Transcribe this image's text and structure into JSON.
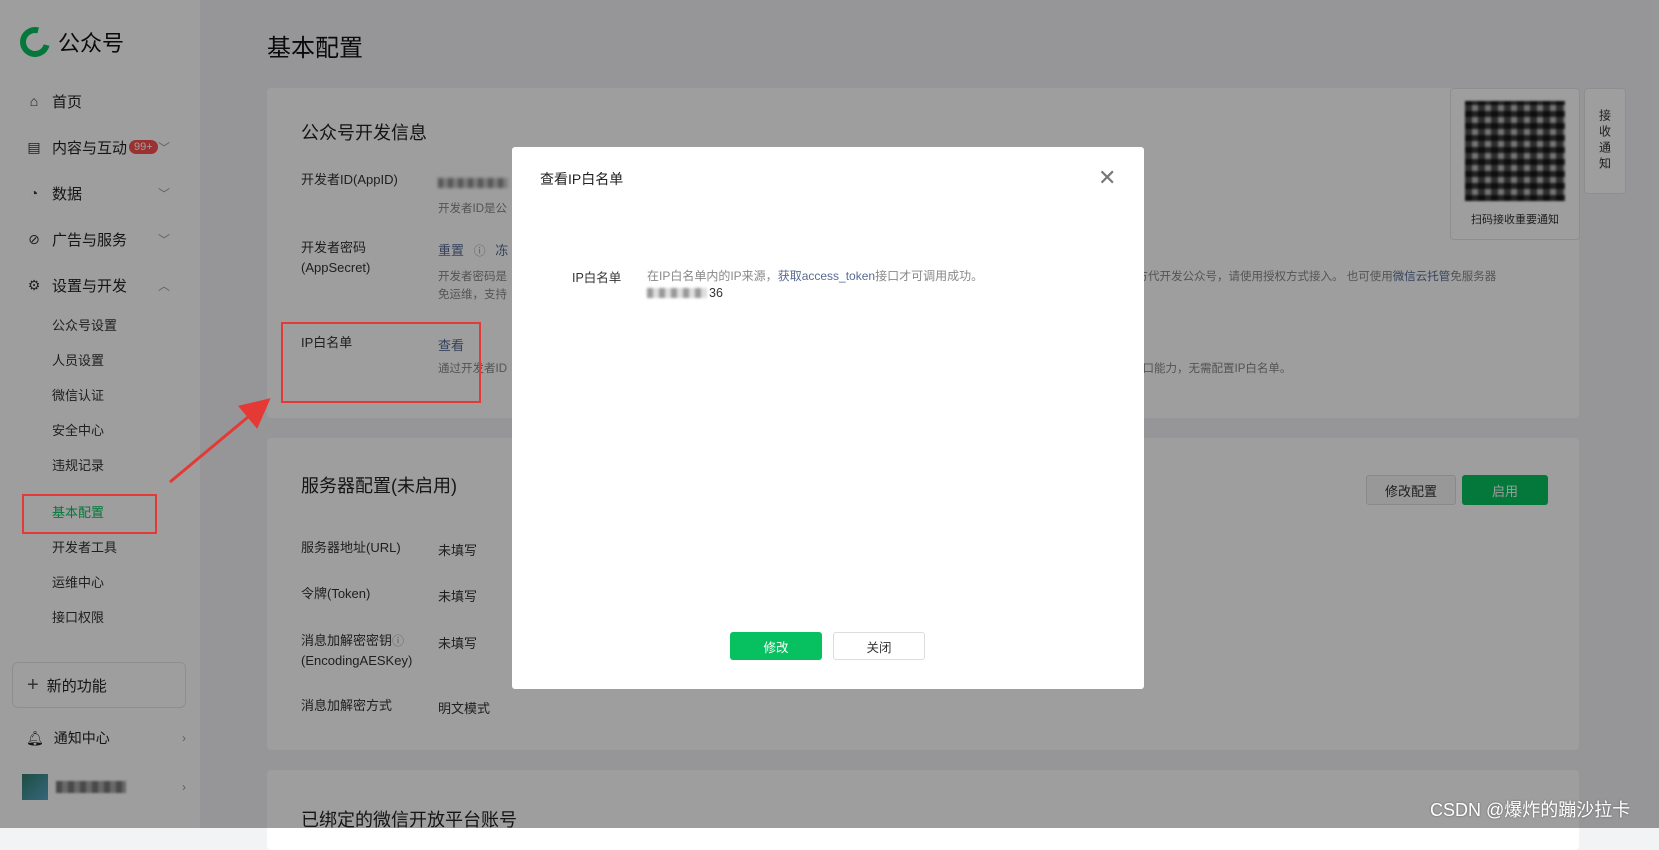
{
  "app": {
    "logo_text": "公众号"
  },
  "sidebar": {
    "items": [
      {
        "label": "首页",
        "icon": "home-icon"
      },
      {
        "label": "内容与互动",
        "icon": "document-icon",
        "badge": "99+"
      },
      {
        "label": "数据",
        "icon": "chart-pie-icon"
      },
      {
        "label": "广告与服务",
        "icon": "compass-icon"
      },
      {
        "label": "设置与开发",
        "icon": "gear-icon"
      }
    ],
    "sub_items": [
      "公众号设置",
      "人员设置",
      "微信认证",
      "安全中心",
      "违规记录",
      "基本配置",
      "开发者工具",
      "运维中心",
      "接口权限"
    ],
    "active_sub": "基本配置",
    "new_feature": "新的功能",
    "notifications": "通知中心"
  },
  "page": {
    "title": "基本配置"
  },
  "dev_info": {
    "title": "公众号开发信息",
    "appid_label": "开发者ID(AppID)",
    "appid_hint": "开发者ID是公",
    "secret_label": "开发者密码(AppSecret)",
    "secret_reset": "重置",
    "secret_freeze": "冻",
    "secret_hint_1": "开发者密码是",
    "secret_hint_2": "免运维，支持",
    "secret_hint_right": "三方代开发公众号，请使用授权方式接入。 也可使用",
    "secret_hint_link": "微信云托管",
    "secret_hint_tail": "免服务器",
    "ip_label": "IP白名单",
    "ip_view": "查看",
    "ip_hint_left": "通过开发者ID",
    "ip_hint_right": "众号接口能力，无需配置IP白名单。"
  },
  "server_config": {
    "title": "服务器配置(未启用)",
    "modify_button": "修改配置",
    "enable_button": "启用",
    "rows": [
      {
        "label": "服务器地址(URL)",
        "value": "未填写"
      },
      {
        "label": "令牌(Token)",
        "value": "未填写"
      },
      {
        "label": "消息加解密密钥",
        "label2": "(EncodingAESKey)",
        "value": "未填写"
      },
      {
        "label": "消息加解密方式",
        "value": "明文模式"
      }
    ]
  },
  "bound_section": {
    "title": "已绑定的微信开放平台账号"
  },
  "qr": {
    "label": "扫码接收重要通知"
  },
  "side_tab": {
    "label": "接收通知"
  },
  "dialog": {
    "title": "查看IP白名单",
    "field_label": "IP白名单",
    "hint_prefix": "在IP白名单内的IP来源，",
    "hint_link": "获取access_token",
    "hint_suffix": "接口才可调用成功。",
    "ip_visible_suffix": "36",
    "modify_button": "修改",
    "close_button": "关闭"
  },
  "watermark": "CSDN @爆炸的蹦沙拉卡",
  "colors": {
    "accent": "#07c160",
    "link": "#576b95",
    "annotation": "#e53935"
  }
}
